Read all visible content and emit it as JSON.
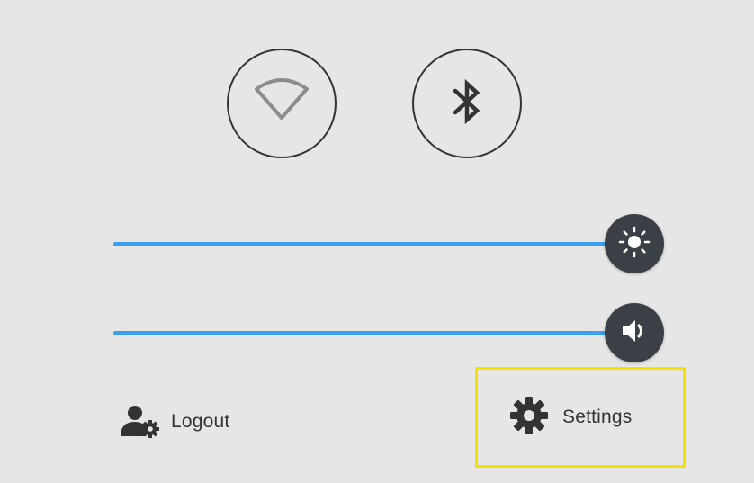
{
  "toggles": {
    "wifi": {
      "icon": "wifi-icon",
      "state": "off"
    },
    "bluetooth": {
      "icon": "bluetooth-icon",
      "state": "on"
    }
  },
  "sliders": {
    "brightness": {
      "icon": "brightness-icon",
      "level": 1.0
    },
    "volume": {
      "icon": "volume-icon",
      "level": 1.0
    }
  },
  "actions": {
    "logout_label": "Logout",
    "settings_label": "Settings"
  },
  "colors": {
    "background": "#e6e6e6",
    "slider_fill": "#3aa0ee",
    "slider_thumb": "#3b3f46",
    "foreground": "#333333",
    "wifi_off": "#8c8c8c",
    "focus_highlight": "#f5e000"
  }
}
